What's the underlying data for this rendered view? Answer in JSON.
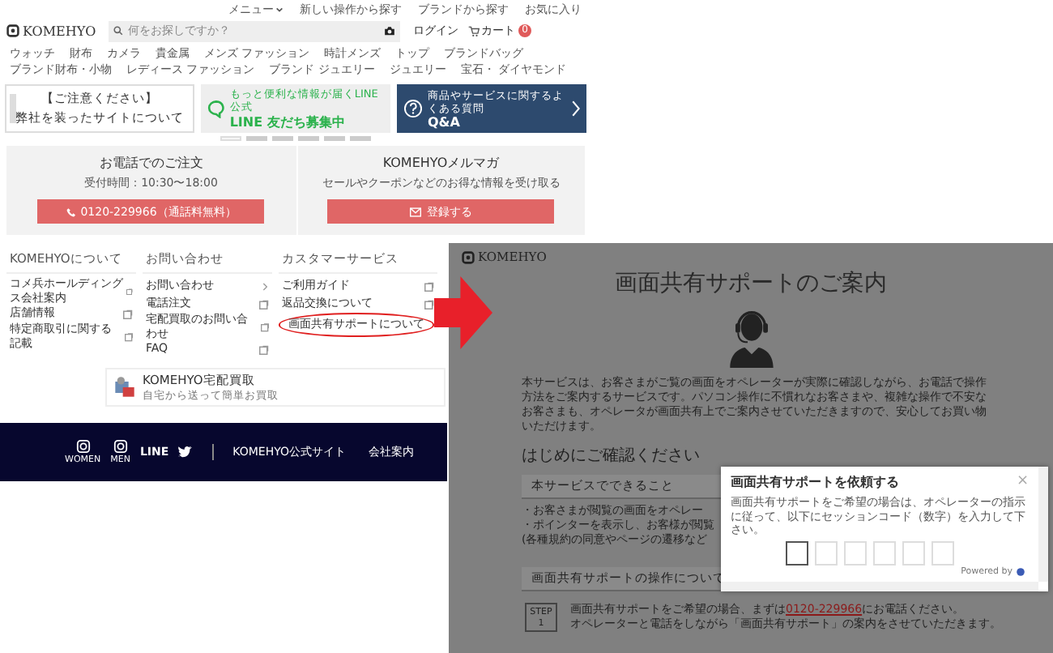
{
  "left_page": {
    "utility_links": [
      {
        "label": "メニュー",
        "dropdown": true
      },
      {
        "label": "新しい操作から探す",
        "dropdown": false
      },
      {
        "label": "ブランドから探す",
        "dropdown": false
      },
      {
        "label": "お気に入り",
        "dropdown": false
      }
    ],
    "logo": "KOMEHYO",
    "search": {
      "placeholder": "何をお探しですか？"
    },
    "login": "ログイン",
    "cart": {
      "label": "カート",
      "count": "0"
    },
    "categories": [
      "ウォッチ",
      "財布",
      "カメラ",
      "貴金属",
      "メンズ ファッション",
      "時計メンズ",
      "トップ",
      "ブランドバッグ",
      "ブランド財布・小物",
      "レディース ファッション",
      "ブランド ジュエリー",
      "ジュエリー",
      "宝石・ ダイヤモンド"
    ],
    "banners": [
      {
        "kind": "notice",
        "caption": "【ご注意ください】",
        "text": "弊社を装ったサイトについて"
      },
      {
        "kind": "line",
        "caption": "もっと便利な情報が届くLINE公式",
        "text": "LINE 友だち募集中"
      },
      {
        "kind": "qa",
        "caption": "商品やサービスに関するよくある質問",
        "text": "Q&A"
      }
    ],
    "carousel_dots": [
      {
        "selected": true
      },
      {
        "selected": false
      },
      {
        "selected": false
      },
      {
        "selected": false
      },
      {
        "selected": false
      },
      {
        "selected": false
      }
    ],
    "contact": [
      {
        "kind": "phone",
        "title": "お電話でのご注文",
        "subtitle": "受付時間：10:30〜18:00",
        "button": "0120-229966（通話料無料）"
      },
      {
        "kind": "mail",
        "title": "KOMEHYOメルマガ",
        "subtitle": "セールやクーポンなどのお得な情報を受け取る",
        "button": "登録する"
      }
    ],
    "footer_columns": [
      {
        "heading": "KOMEHYOについて",
        "links": [
          {
            "label": "コメ兵ホールディングス会社案内",
            "kind": "external",
            "highlighted": false
          },
          {
            "label": "店舗情報",
            "kind": "external",
            "highlighted": false
          },
          {
            "label": "特定商取引に関する記載",
            "kind": "external",
            "highlighted": false
          }
        ]
      },
      {
        "heading": "お問い合わせ",
        "links": [
          {
            "label": "お問い合わせ",
            "kind": "internal",
            "highlighted": false
          },
          {
            "label": "電話注文",
            "kind": "external",
            "highlighted": false
          },
          {
            "label": "宅配買取のお問い合わせ",
            "kind": "external",
            "highlighted": false
          },
          {
            "label": "FAQ",
            "kind": "external",
            "highlighted": false
          }
        ]
      },
      {
        "heading": "カスタマーサービス",
        "links": [
          {
            "label": "ご利用ガイド",
            "kind": "external",
            "highlighted": false
          },
          {
            "label": "返品交換について",
            "kind": "external",
            "highlighted": false
          },
          {
            "label": "画面共有サポートについて",
            "kind": "plain",
            "highlighted": true
          }
        ]
      }
    ],
    "app_banner": {
      "title": "KOMEHYO宅配買取",
      "text": "自宅から送って簡単お買取"
    },
    "footer_bar": {
      "social": [
        {
          "kind": "instagram",
          "label": "WOMEN"
        },
        {
          "kind": "instagram",
          "label": "MEN"
        },
        {
          "kind": "line",
          "label": "LINE"
        },
        {
          "kind": "twitter"
        }
      ],
      "links": [
        "KOMEHYO公式サイト",
        "会社案内"
      ]
    }
  },
  "right_page": {
    "logo": "KOMEHYO",
    "title": "画面共有サポートのご案内",
    "intro": "本サービスは、お客さまがご覧の画面をオペレーターが実際に確認しながら、お電話で操作方法をご案内するサービスです。パソコン操作に不慣れなお客さまや、複雑な操作で不安なお客さまも、オペレータが画面共有上でご案内させていただきますので、安心してお買い物いただけます。",
    "check_heading": "はじめにご確認ください",
    "sections": [
      {
        "title": "本サービスでできること",
        "bullets": [
          "・お客さまが閲覧の画面をオペレー",
          "・ポインターを表示し、お客様が閲覧",
          "(各種規約の同意やページの遷移など"
        ]
      },
      {
        "title": "画面共有サポートの操作について"
      }
    ],
    "step": {
      "label": "STEP",
      "number": "1",
      "before": "画面共有サポートをご希望の場合、まずは",
      "link": "0120-229966",
      "after": "にお電話ください。",
      "line2": "オペレーターと電話をしながら「画面共有サポート」の案内をさせていただきます。"
    },
    "modal": {
      "title": "画面共有サポートを依頼する",
      "close": "×",
      "text": "画面共有サポートをご希望の場合は、オペレーターの指示に従って、以下にセッションコード（数字）を入力して下さい。",
      "code_fields": [
        {
          "focused": true
        },
        {
          "focused": false
        },
        {
          "focused": false
        },
        {
          "focused": false
        },
        {
          "focused": false
        },
        {
          "focused": false
        }
      ],
      "powered_by": "Powered by"
    }
  }
}
